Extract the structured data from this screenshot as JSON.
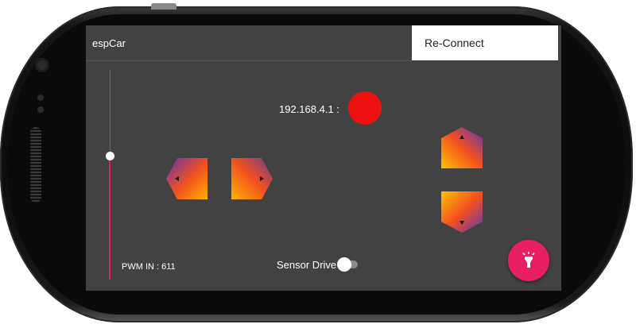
{
  "app": {
    "title": "espCar"
  },
  "toolbar": {
    "reconnect_label": "Re-Connect"
  },
  "connection": {
    "ip_label": "192.168.4.1 :",
    "status_color": "#ee1111"
  },
  "pwm": {
    "label": "PWM IN : 611",
    "slider_level_percent": 65
  },
  "sensor_drive": {
    "label": "Sensor Drive",
    "enabled": false
  },
  "controls": {
    "left_icon": "arrow-left-icon",
    "right_icon": "arrow-right-icon",
    "up_icon": "arrow-up-icon",
    "down_icon": "arrow-down-icon",
    "fab_icon": "flashlight-icon"
  },
  "colors": {
    "accent": "#e91e63",
    "screen_background": "#424242",
    "button_gradient_start": "#ffb300",
    "button_gradient_end": "#5a3a8c"
  }
}
